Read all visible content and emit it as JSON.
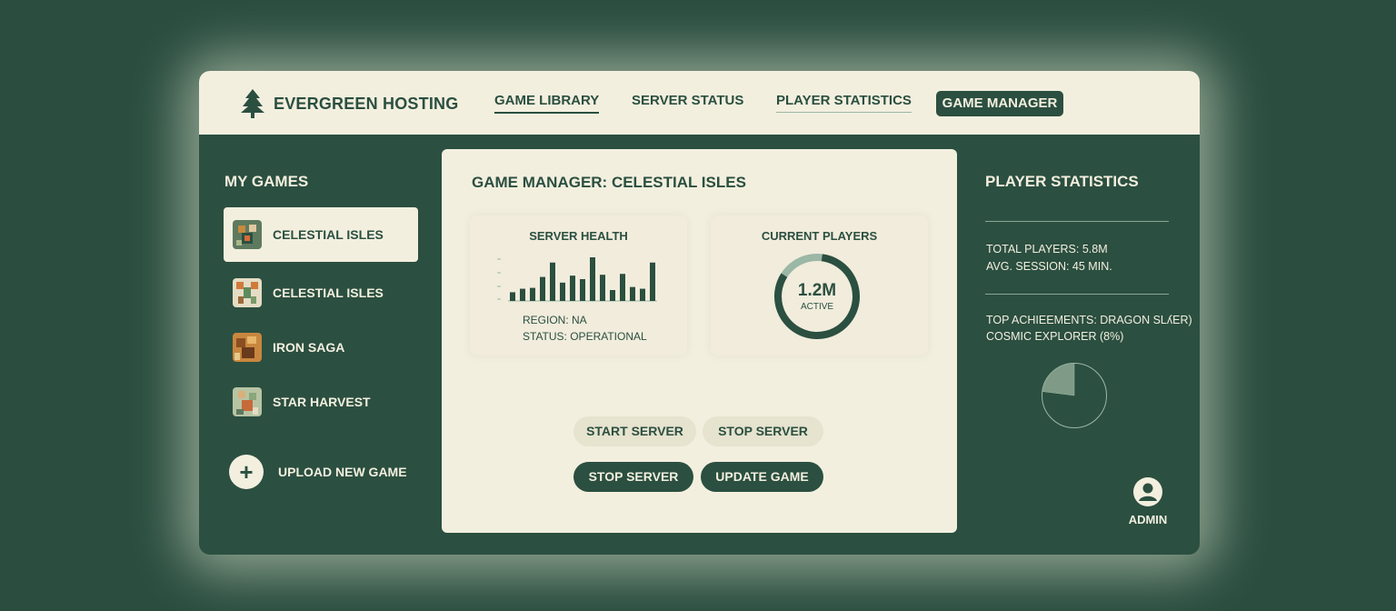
{
  "brand": {
    "name": "EVERGREEN HOSTING",
    "icon": "pine-tree-icon"
  },
  "nav": {
    "game_library": "GAME LIBRARY",
    "server_status": "SERVER STATUS",
    "player_statistics": "PLAYER STATISTICS",
    "game_manager": "GAME MANAGER"
  },
  "sidebar": {
    "title": "MY GAMES",
    "items": [
      {
        "label": "CELESTIAL ISLES",
        "selected": true
      },
      {
        "label": "CELESTIAL ISLES",
        "selected": false
      },
      {
        "label": "IRON SAGA",
        "selected": false
      },
      {
        "label": "STAR HARVEST",
        "selected": false
      }
    ],
    "upload_label": "UPLOAD NEW GAME"
  },
  "main": {
    "title": "GAME MANAGER: CELESTIAL ISLES",
    "server_health": {
      "title": "SERVER HEALTH",
      "region": "REGION: NA",
      "status": "STATUS: OPERATIONAL",
      "bars": [
        0.2,
        0.28,
        0.3,
        0.55,
        0.88,
        0.42,
        0.58,
        0.5,
        1.0,
        0.6,
        0.25,
        0.62,
        0.32,
        0.28,
        0.88
      ]
    },
    "current_players": {
      "title": "CURRENT PLAYERS",
      "value": "1.2M",
      "sublabel": "ACTIVE",
      "ring_fraction": 0.82
    },
    "buttons": {
      "start_server": "START SERVER",
      "stop_server_light": "STOP SERVER",
      "stop_server_dark": "STOP SERVER",
      "update_game": "UPDATE GAME"
    }
  },
  "stats": {
    "title": "PLAYER STATISTICS",
    "total_players": "TOTAL PLAYERS: 5.8M",
    "avg_session": "AVG. SESSION: 45 MIN.",
    "achievements_line1": "TOP ACHIEEMENTS: DRAGON SLʎER)",
    "achievements_line2": "COSMIC EXPLORER (8%)",
    "pie_fraction": 0.23
  },
  "admin": {
    "label": "ADMIN",
    "icon": "user-avatar-icon"
  },
  "colors": {
    "primary": "#2b4f40",
    "cream": "#f3efdf",
    "accent_light": "#9bb7a6"
  }
}
